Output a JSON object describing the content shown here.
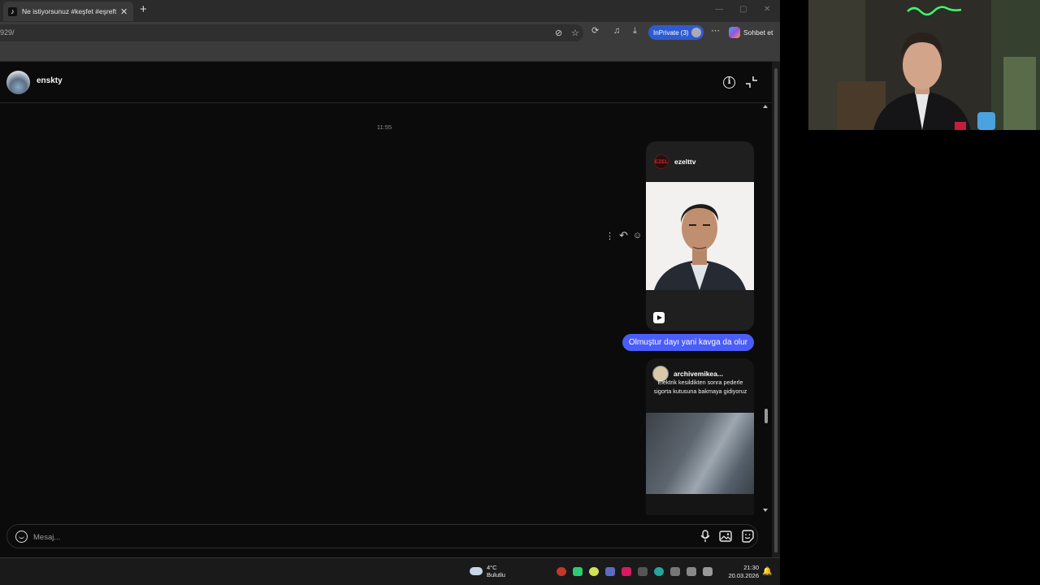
{
  "browser": {
    "tab_title": "Ne istiyorsunuz #keşfet #eşreftek",
    "tab_favicon": "tiktok-icon",
    "url": "929/",
    "inprivate_label": "InPrivate (3)",
    "chat_button_label": "Sohbet et"
  },
  "chat": {
    "username": "enskty",
    "timestamp": "11:55",
    "shared_post_1": {
      "account": "ezelttv",
      "logo_text": "EZEL"
    },
    "sent_message": "Olmuştur dayı yani kavga da olur",
    "shared_post_2": {
      "account": "archivemikea...",
      "caption": "Elektrik kesildikten sonra pederle sigorta kutusuna bakmaya gidiyoruz"
    },
    "message_placeholder": "Mesaj..."
  },
  "taskbar": {
    "temperature": "4°C",
    "weather_condition": "Bulutlu",
    "time": "21:30",
    "date": "20.03.2026"
  },
  "colors": {
    "accent_blue": "#4a5df9",
    "inprivate_blue": "#2f5bd1",
    "page_bg": "#0b0b0b"
  }
}
